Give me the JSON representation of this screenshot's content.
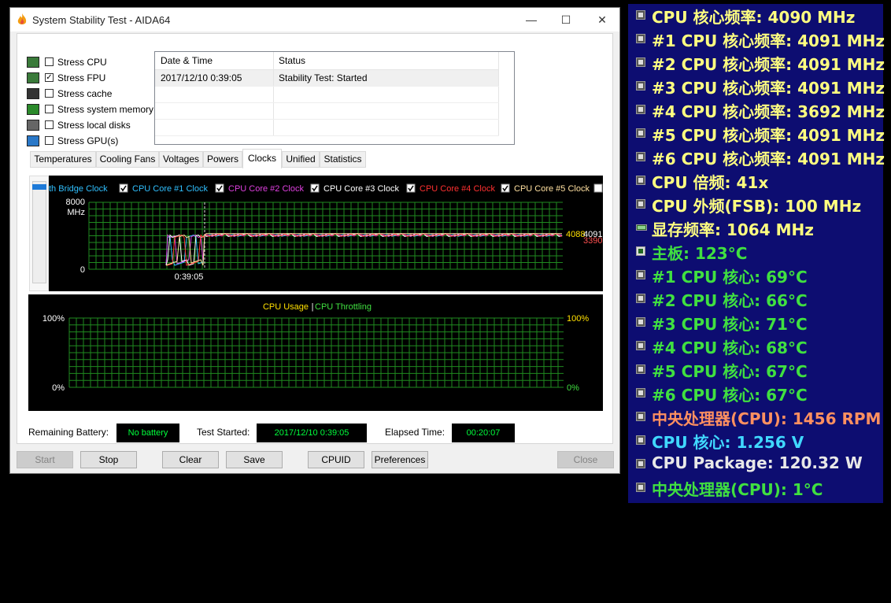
{
  "window": {
    "title": "System Stability Test - AIDA64",
    "controls": {
      "minimize": "—",
      "maximize": "☐",
      "close": "✕"
    }
  },
  "stress_options": [
    {
      "label": "Stress CPU",
      "checked": false,
      "icon": "cpu-chip-icon"
    },
    {
      "label": "Stress FPU",
      "checked": true,
      "icon": "fpu-percent-icon"
    },
    {
      "label": "Stress cache",
      "checked": false,
      "icon": "cache-chip-icon"
    },
    {
      "label": "Stress system memory",
      "checked": false,
      "icon": "memory-module-icon"
    },
    {
      "label": "Stress local disks",
      "checked": false,
      "icon": "disk-drive-icon"
    },
    {
      "label": "Stress GPU(s)",
      "checked": false,
      "icon": "monitor-icon"
    }
  ],
  "log": {
    "columns": [
      "Date & Time",
      "Status"
    ],
    "rows": [
      {
        "datetime": "2017/12/10 0:39:05",
        "status": "Stability Test: Started"
      }
    ]
  },
  "tabs": [
    {
      "label": "Temperatures",
      "active": false
    },
    {
      "label": "Cooling Fans",
      "active": false
    },
    {
      "label": "Voltages",
      "active": false
    },
    {
      "label": "Powers",
      "active": false
    },
    {
      "label": "Clocks",
      "active": true
    },
    {
      "label": "Unified",
      "active": false
    },
    {
      "label": "Statistics",
      "active": false
    }
  ],
  "clock_graph": {
    "legend": [
      {
        "label": "th Bridge Clock",
        "color": "#30c0ff",
        "checkbox": false
      },
      {
        "label": "CPU Core #1 Clock",
        "color": "#30c0ff",
        "checkbox": true
      },
      {
        "label": "CPU Core #2 Clock",
        "color": "#e040e0",
        "checkbox": true
      },
      {
        "label": "CPU Core #3 Clock",
        "color": "#ffffff",
        "checkbox": true
      },
      {
        "label": "CPU Core #4 Clock",
        "color": "#ff3030",
        "checkbox": true
      },
      {
        "label": "CPU Core #5 Clock",
        "color": "#ffe0a0",
        "checkbox": true
      }
    ],
    "y_max_label": "8000",
    "y_unit": "MHz",
    "y_min_label": "0",
    "x_label": "0:39:05",
    "right_values": [
      {
        "text": "4088",
        "color": "#ffe000"
      },
      {
        "text": "4091",
        "color": "#ffffff"
      },
      {
        "text": "3390",
        "color": "#ff5050"
      }
    ],
    "y_max": 8000,
    "level": 4088
  },
  "usage_graph": {
    "title_usage": "CPU Usage",
    "separator": "|",
    "title_throttling": "CPU Throttling",
    "left_top": "100%",
    "left_bottom": "0%",
    "right_top": "100%",
    "right_bottom": "0%"
  },
  "status": {
    "battery_label": "Remaining Battery:",
    "battery_value": "No battery",
    "started_label": "Test Started:",
    "started_value": "2017/12/10 0:39:05",
    "elapsed_label": "Elapsed Time:",
    "elapsed_value": "00:20:07"
  },
  "buttons": {
    "start": "Start",
    "stop": "Stop",
    "clear": "Clear",
    "save": "Save",
    "cpuid": "CPUID",
    "preferences": "Preferences",
    "close": "Close"
  },
  "osd": [
    {
      "text": "CPU 核心频率: 4090 MHz",
      "color": "#ffff80",
      "icon": "cpu"
    },
    {
      "text": "#1 CPU 核心频率: 4091 MHz",
      "color": "#ffff80",
      "icon": "cpu"
    },
    {
      "text": "#2 CPU 核心频率: 4091 MHz",
      "color": "#ffff80",
      "icon": "cpu"
    },
    {
      "text": "#3 CPU 核心频率: 4091 MHz",
      "color": "#ffff80",
      "icon": "cpu"
    },
    {
      "text": "#4 CPU 核心频率: 3692 MHz",
      "color": "#ffff80",
      "icon": "cpu"
    },
    {
      "text": "#5 CPU 核心频率: 4091 MHz",
      "color": "#ffff80",
      "icon": "cpu"
    },
    {
      "text": "#6 CPU 核心频率: 4091 MHz",
      "color": "#ffff80",
      "icon": "cpu"
    },
    {
      "text": "CPU 倍频: 41x",
      "color": "#ffff80",
      "icon": "cpu"
    },
    {
      "text": "CPU 外频(FSB): 100 MHz",
      "color": "#ffff80",
      "icon": "cpu"
    },
    {
      "text": "显存频率: 1064 MHz",
      "color": "#ffff80",
      "icon": "gpu"
    },
    {
      "text": "主板: 123°C",
      "color": "#40e040",
      "icon": "mb"
    },
    {
      "text": " #1 CPU 核心: 69°C",
      "color": "#40e040",
      "icon": "cpu"
    },
    {
      "text": " #2 CPU 核心: 66°C",
      "color": "#40e040",
      "icon": "cpu"
    },
    {
      "text": " #3 CPU 核心: 71°C",
      "color": "#40e040",
      "icon": "cpu"
    },
    {
      "text": " #4 CPU 核心: 68°C",
      "color": "#40e040",
      "icon": "cpu"
    },
    {
      "text": " #5 CPU 核心: 67°C",
      "color": "#40e040",
      "icon": "cpu"
    },
    {
      "text": " #6 CPU 核心: 67°C",
      "color": "#40e040",
      "icon": "cpu"
    },
    {
      "text": "中央处理器(CPU): 1456 RPM",
      "color": "#ff9060",
      "icon": "cpu"
    },
    {
      "text": "CPU 核心: 1.256 V",
      "color": "#40d8ff",
      "icon": "cpu"
    },
    {
      "text": "CPU Package: 120.32 W",
      "color": "#e8e8e8",
      "icon": "cpu"
    },
    {
      "text": "中央处理器(CPU): 1°C",
      "color": "#40e040",
      "icon": "cpu"
    }
  ]
}
